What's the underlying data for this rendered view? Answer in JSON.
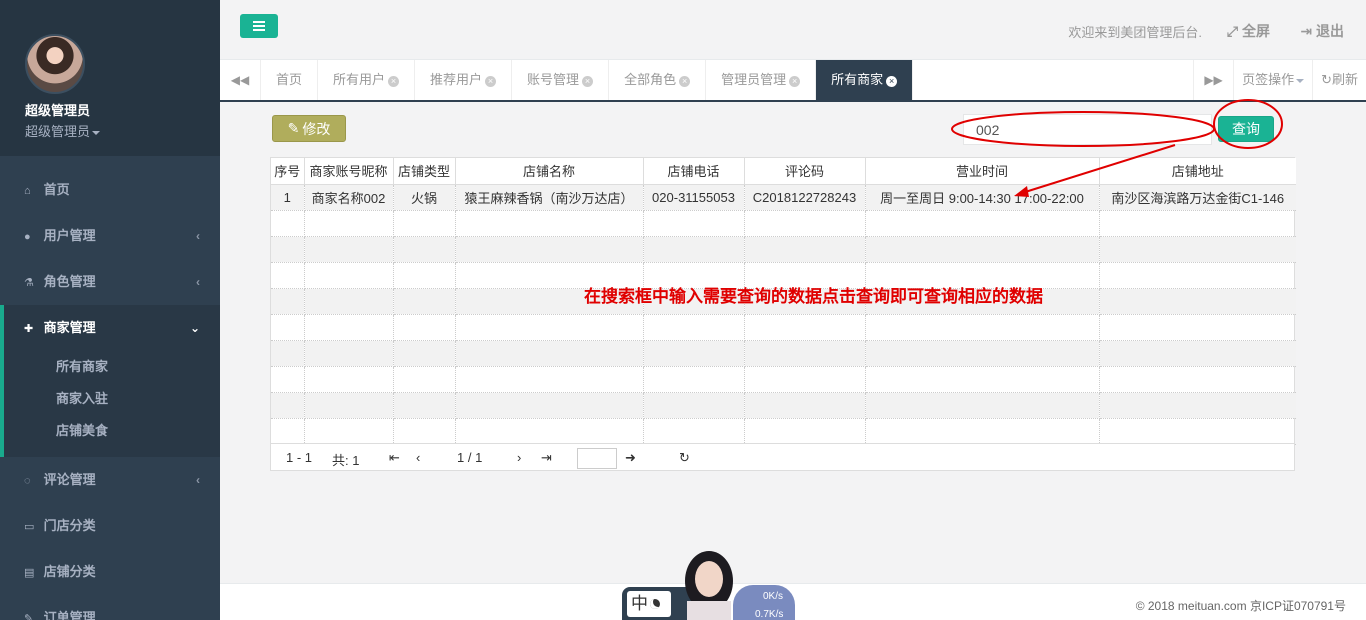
{
  "profile": {
    "name": "超级管理员",
    "role": "超级管理员"
  },
  "sidebar": {
    "items": [
      {
        "label": "首页",
        "icon": "home-icon"
      },
      {
        "label": "用户管理",
        "icon": "user-icon",
        "arrow": "‹"
      },
      {
        "label": "角色管理",
        "icon": "flask-icon",
        "arrow": "‹"
      },
      {
        "label": "商家管理",
        "icon": "user-plus-icon",
        "arrow": "⌄",
        "children": [
          "所有商家",
          "商家入驻",
          "店铺美食"
        ]
      },
      {
        "label": "评论管理",
        "icon": "comment-icon",
        "arrow": "‹"
      },
      {
        "label": "门店分类",
        "icon": "desktop-icon"
      },
      {
        "label": "店铺分类",
        "icon": "document-icon"
      },
      {
        "label": "订单管理",
        "icon": "edit-icon"
      }
    ]
  },
  "header": {
    "welcome": "欢迎来到美团管理后台.",
    "fullscreen": "全屏",
    "logout": "退出"
  },
  "tabs": {
    "items": [
      "首页",
      "所有用户",
      "推荐用户",
      "账号管理",
      "全部角色",
      "管理员管理",
      "所有商家"
    ],
    "active": "所有商家",
    "page_ops": "页签操作",
    "refresh": "刷新"
  },
  "toolbar": {
    "edit_label": "修改"
  },
  "search": {
    "value": "002",
    "button_label": "查询"
  },
  "table": {
    "columns": [
      "序号",
      "商家账号昵称",
      "店铺类型",
      "店铺名称",
      "店铺电话",
      "评论码",
      "营业时间",
      "店铺地址"
    ],
    "rows": [
      [
        "1",
        "商家名称002",
        "火锅",
        "猿王麻辣香锅（南沙万达店）",
        "020-31155053",
        "C2018122728243",
        "周一至周日 9:00-14:30 17:00-22:00",
        "南沙区海滨路万达金街C1-146"
      ]
    ]
  },
  "pager": {
    "range": "1 - 1",
    "total": "共: 1",
    "pages": "1 / 1"
  },
  "annotation": "在搜索框中输入需要查询的数据点击查询即可查询相应的数据",
  "footer": {
    "copyright": "© 2018 meituan.com 京ICP证070791号"
  },
  "widget": {
    "ime_char": "中",
    "speed_up": "0K/s",
    "speed_down": "0.7K/s"
  },
  "colors": {
    "sidebar": "#2f4050",
    "accent": "#1ab394",
    "edit_button": "#b0ad5c",
    "annotation": "#e00000"
  }
}
